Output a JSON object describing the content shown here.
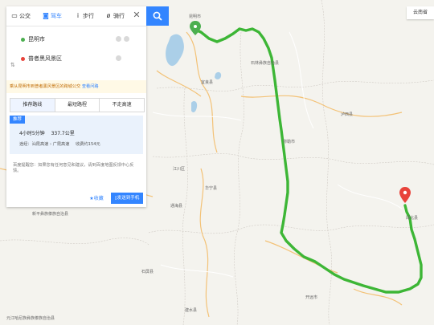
{
  "modes": [
    {
      "label": "公交",
      "icon": "bus-icon"
    },
    {
      "label": "驾车",
      "icon": "car-icon"
    },
    {
      "label": "步行",
      "icon": "walk-icon"
    },
    {
      "label": "骑行",
      "icon": "bike-icon"
    }
  ],
  "active_mode": "驾车",
  "start": {
    "value": "昆明市"
  },
  "end": {
    "value": "普者黑风景区"
  },
  "notice": {
    "text": "乘从昆明市到普者黑风景区的跨城公交",
    "link": "查看问路"
  },
  "tabs": [
    "推荐路线",
    "最短路程",
    "不走高速"
  ],
  "route": {
    "label": "推荐",
    "duration": "4小时5分钟",
    "distance": "337.7公里",
    "via": "途经：汕昆高速 › 广昆高速",
    "toll": "收费约154元"
  },
  "tip": "百度提醒您：如果您有任何意见和建议，请到百度地图反馈中心反馈。",
  "actions": {
    "favorite": "收藏",
    "send_phone": "发送到手机"
  },
  "city_tag": "云南省",
  "map_labels": [
    "昆明市",
    "石林彝族自治县",
    "宜良县",
    "泸西县",
    "弥勒市",
    "邱北县",
    "江川区",
    "华宁县",
    "通海县",
    "新平彝族傣族自治县",
    "石屏县",
    "建水县",
    "元江哈尼族彝族傣族自治县",
    "开远市"
  ],
  "colors": {
    "route": "#3db636",
    "accent": "#3385ff",
    "water": "#abcfe8",
    "end_pin": "#e8433b",
    "start_pin": "#4caf50"
  }
}
